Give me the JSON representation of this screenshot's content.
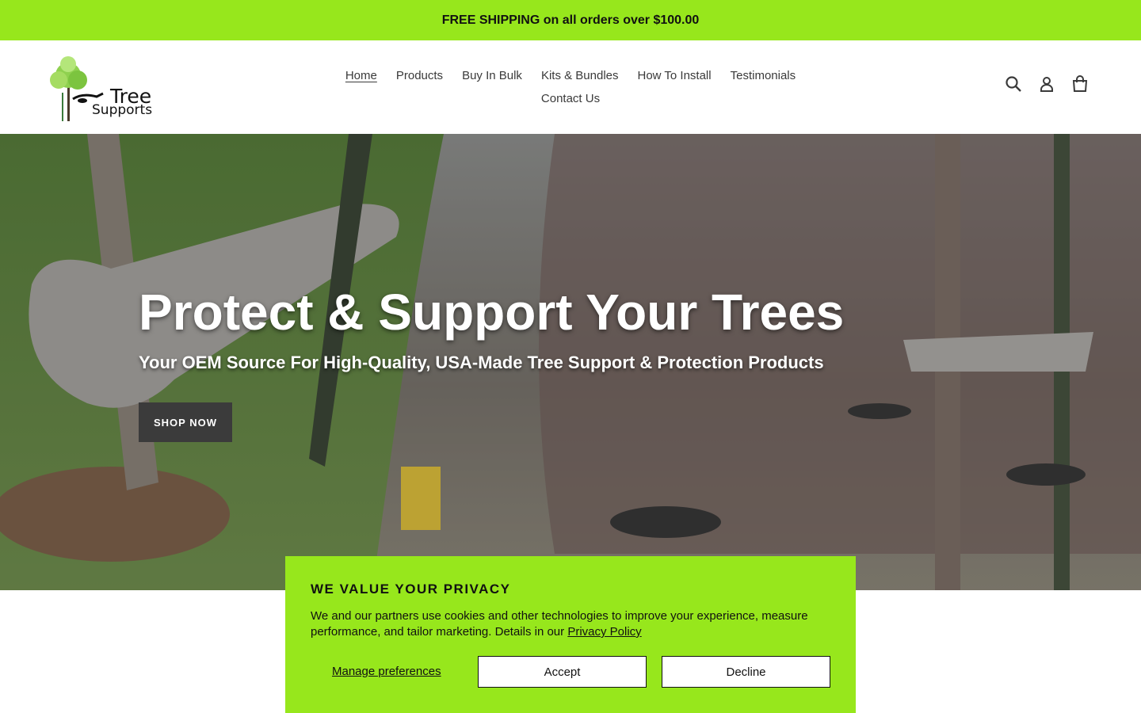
{
  "announcement": {
    "text": "FREE SHIPPING on all orders over $100.00"
  },
  "header": {
    "logo": {
      "line1": "Tree",
      "line2": "Supports"
    },
    "nav": [
      {
        "label": "Home",
        "active": true
      },
      {
        "label": "Products"
      },
      {
        "label": "Buy In Bulk"
      },
      {
        "label": "Kits & Bundles"
      },
      {
        "label": "How To Install"
      },
      {
        "label": "Testimonials"
      },
      {
        "label": "Contact Us"
      }
    ],
    "icons": [
      "search-icon",
      "account-icon",
      "cart-icon"
    ]
  },
  "hero": {
    "title": "Protect & Support Your Trees",
    "subtitle": "Your OEM Source For High-Quality, USA-Made Tree Support & Protection Products",
    "cta": "SHOP NOW"
  },
  "cookie": {
    "title": "WE VALUE YOUR PRIVACY",
    "text": "We and our partners use cookies and other technologies to improve your experience, measure performance, and tailor marketing. Details in our",
    "policy_link": "Privacy Policy",
    "manage": "Manage preferences",
    "accept": "Accept",
    "decline": "Decline"
  },
  "colors": {
    "accent": "#97e71c",
    "button_dark": "#3b3b3b"
  }
}
